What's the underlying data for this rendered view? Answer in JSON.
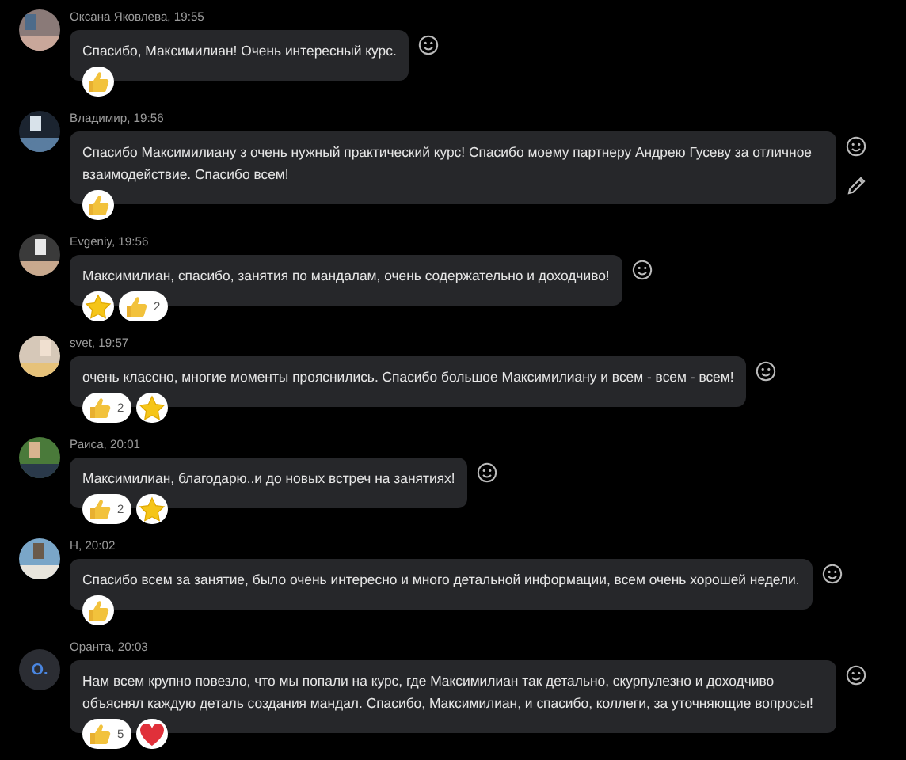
{
  "messages": [
    {
      "header": "Оксана Яковлева, 19:55",
      "avatar": {
        "kind": "picture"
      },
      "text": "Спасибо, Максимилиан! Очень интересный курс.",
      "reactions": [
        {
          "kind": "like"
        }
      ],
      "editable": false
    },
    {
      "header": "Владимир, 19:56",
      "avatar": {
        "kind": "picture"
      },
      "text": "Спасибо Максимилиану з очень нужный практический курс! Спасибо моему партнеру Андрею Гусеву за отличное взаимодействие. Спасибо всем!",
      "reactions": [
        {
          "kind": "like"
        }
      ],
      "editable": true
    },
    {
      "header": "Evgeniy, 19:56",
      "avatar": {
        "kind": "picture"
      },
      "text": "Максимилиан, спасибо, занятия по мандалам, очень содержательно и доходчиво!",
      "reactions": [
        {
          "kind": "star"
        },
        {
          "kind": "like",
          "count": "2"
        }
      ],
      "editable": false
    },
    {
      "header": "svet, 19:57",
      "avatar": {
        "kind": "picture"
      },
      "text": "очень классно, многие моменты прояснились. Спасибо большое Максимилиану и всем - всем - всем!",
      "reactions": [
        {
          "kind": "like",
          "count": "2"
        },
        {
          "kind": "star"
        }
      ],
      "editable": false
    },
    {
      "header": "Раиса, 20:01",
      "avatar": {
        "kind": "picture"
      },
      "text": " Максимилиан, благодарю..и до новых встреч на занятиях!",
      "reactions": [
        {
          "kind": "like",
          "count": "2"
        },
        {
          "kind": "star"
        }
      ],
      "editable": false
    },
    {
      "header": "Н, 20:02",
      "avatar": {
        "kind": "picture"
      },
      "text": "Спасибо всем за занятие, было очень интересно и много детальной информации, всем очень хорошей недели.",
      "reactions": [
        {
          "kind": "like"
        }
      ],
      "editable": false
    },
    {
      "header": "Оранта, 20:03",
      "avatar": {
        "kind": "initials",
        "initials": "O."
      },
      "text": "Нам всем крупно повезло, что мы попали на курс, где Максимилиан так детально, скурпулезно и доходчиво объяснял каждую деталь создания мандал. Спасибо, Максимилиан, и спасибо, коллеги, за уточняющие вопросы!",
      "reactions": [
        {
          "kind": "like",
          "count": "5"
        },
        {
          "kind": "heart"
        }
      ],
      "editable": false
    }
  ]
}
